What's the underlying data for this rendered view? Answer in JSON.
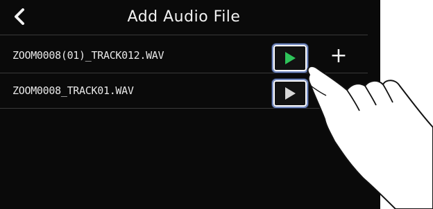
{
  "header": {
    "title": "Add Audio File"
  },
  "files": [
    {
      "name": "ZOOM0008(01)_TRACK012.WAV",
      "play_color": "#2ec45a"
    },
    {
      "name": "ZOOM0008_TRACK01.WAV",
      "play_color": "#d8d8d8"
    }
  ],
  "add_label": "+",
  "icons": {
    "back": "chevron-left-icon",
    "play": "play-icon",
    "add": "plus-icon",
    "hand": "pointing-hand-icon"
  }
}
